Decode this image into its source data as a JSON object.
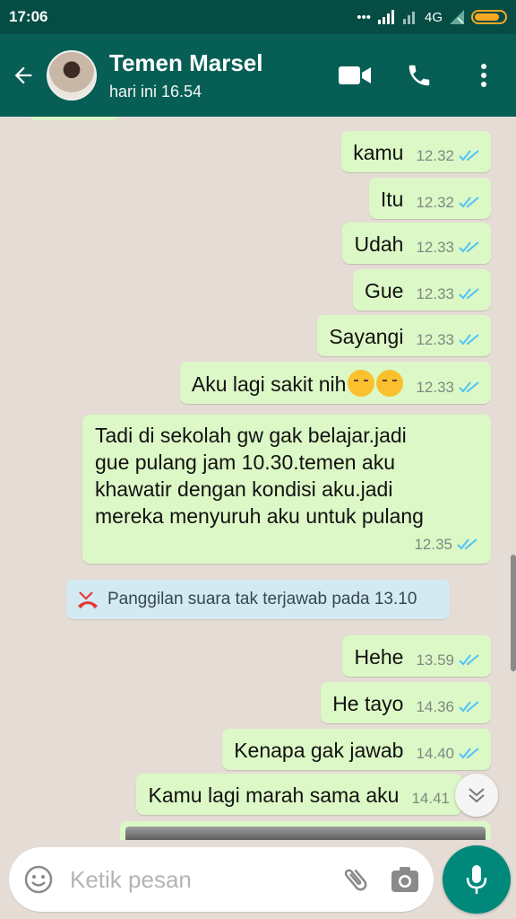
{
  "status_bar": {
    "time": "17:06",
    "network": "4G"
  },
  "header": {
    "contact_name": "Temen Marsel",
    "last_seen": "hari ini 16.54"
  },
  "messages": [
    {
      "text": "kamu",
      "time": "12.32"
    },
    {
      "text": "Itu",
      "time": "12.32"
    },
    {
      "text": "Udah",
      "time": "12.33"
    },
    {
      "text": "Gue",
      "time": "12.33"
    },
    {
      "text": "Sayangi",
      "time": "12.33"
    },
    {
      "text": "Aku lagi sakit nih",
      "time": "12.33"
    },
    {
      "lines": [
        "Tadi di sekolah gw gak belajar.jadi",
        "gue pulang jam 10.30.temen aku",
        "khawatir dengan kondisi aku.jadi",
        "mereka menyuruh aku untuk pulang"
      ],
      "time": "12.35"
    },
    {
      "text": "Hehe",
      "time": "13.59"
    },
    {
      "text": "He tayo",
      "time": "14.36"
    },
    {
      "text": "Kenapa gak jawab",
      "time": "14.40"
    },
    {
      "text": "Kamu lagi marah sama aku",
      "time": "14.41"
    }
  ],
  "system_message": "Panggilan suara tak terjawab pada 13.10",
  "input": {
    "placeholder": "Ketik pesan"
  },
  "colors": {
    "header": "#075e54",
    "status_bar": "#054d44",
    "outgoing_bubble": "#dcf8c6",
    "read_ticks": "#4fc3f7",
    "missed_call": "#e53935",
    "mic_button": "#00897b"
  }
}
